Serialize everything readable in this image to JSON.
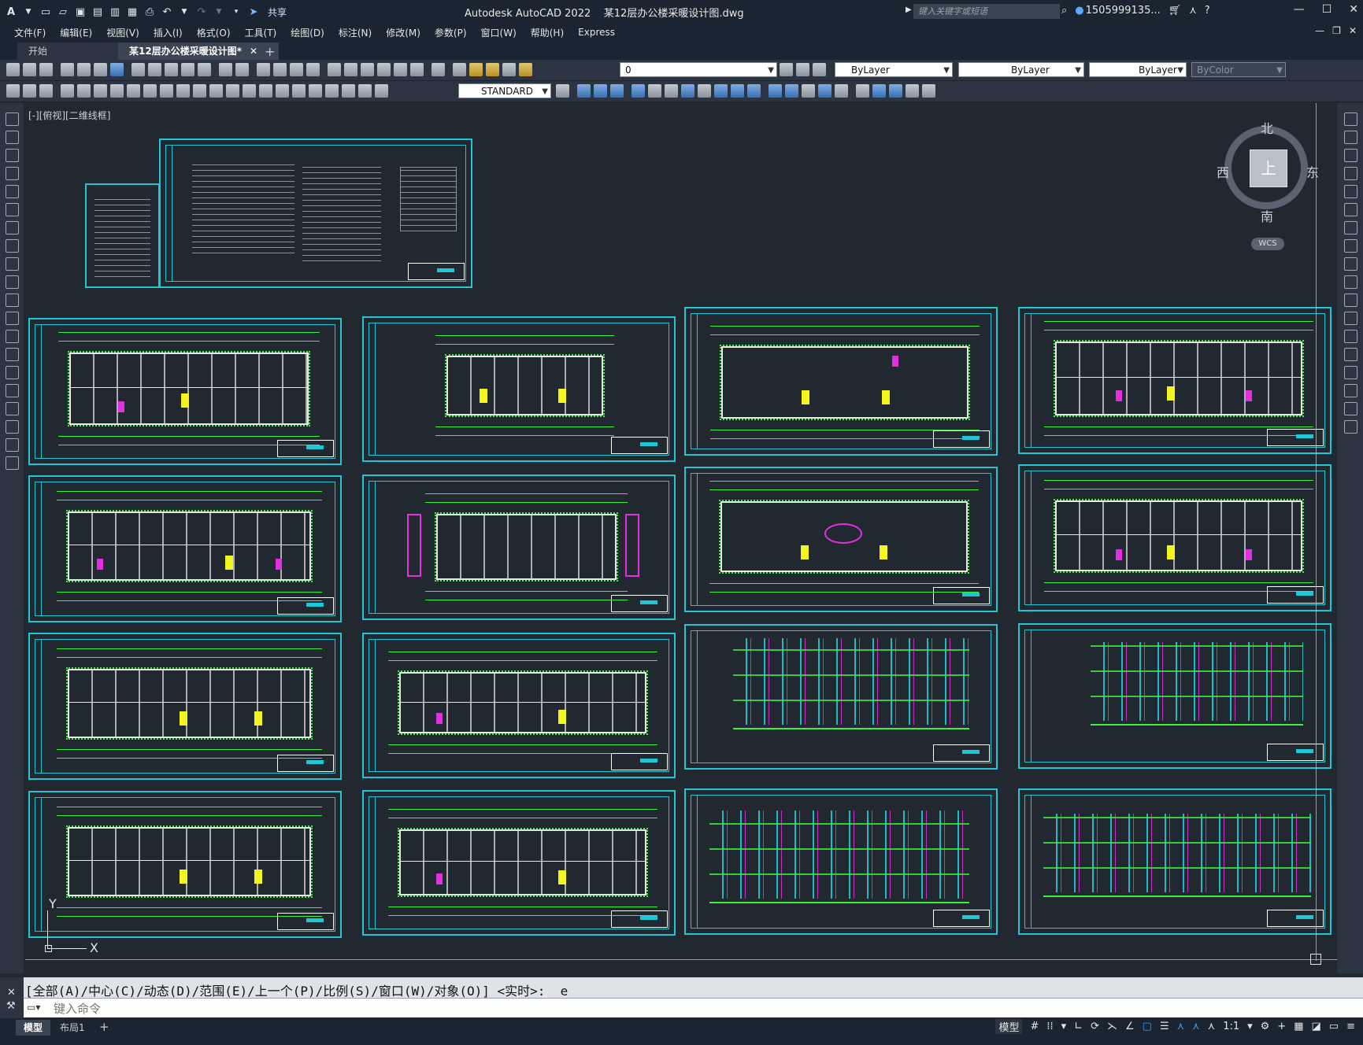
{
  "titlebar": {
    "app_title": "Autodesk AutoCAD 2022    某12层办公楼采暖设计图.dwg",
    "share_label": "共享",
    "search_placeholder": "键入关键字或短语",
    "user_label": "1505999135...",
    "icons": [
      "autocad-logo-icon",
      "new-icon",
      "open-icon",
      "save-icon",
      "save-as-icon",
      "publish-icon",
      "plot-icon",
      "undo-icon",
      "redo-icon",
      "share-icon",
      "search-icon",
      "user-icon",
      "cart-icon",
      "help-icon",
      "minimize-icon",
      "maximize-icon",
      "close-icon"
    ]
  },
  "menu": [
    "文件(F)",
    "编辑(E)",
    "视图(V)",
    "插入(I)",
    "格式(O)",
    "工具(T)",
    "绘图(D)",
    "标注(N)",
    "修改(M)",
    "参数(P)",
    "窗口(W)",
    "帮助(H)",
    "Express"
  ],
  "tabs": {
    "start": "开始",
    "active": "某12层办公楼采暖设计图*"
  },
  "toolbar": {
    "layer": "0",
    "text_style": "STANDARD",
    "color": "ByLayer",
    "linetype": "ByLayer",
    "lineweight": "ByLayer",
    "plotstyle": "ByColor"
  },
  "viewport": {
    "label": "[-][俯视][二维线框]"
  },
  "viewcube": {
    "north": "北",
    "south": "南",
    "east": "东",
    "west": "西",
    "face": "上",
    "wcs": "WCS"
  },
  "ucs": {
    "x": "X",
    "y": "Y"
  },
  "command": {
    "history": "[全部(A)/中心(C)/动态(D)/范围(E)/上一个(P)/比例(S)/窗口(W)/对象(O)] <实时>: _e",
    "placeholder": "键入命令"
  },
  "status": {
    "model_tab": "模型",
    "layout_tab": "布局1",
    "model_label": "模型",
    "scale": "1:1"
  },
  "colors": {
    "frame": "#1fc7d4",
    "pipe_green": "#3ef03e",
    "riser_magenta": "#e030e0",
    "highlight_yellow": "#f5f51e",
    "canvas_bg": "#212830"
  }
}
